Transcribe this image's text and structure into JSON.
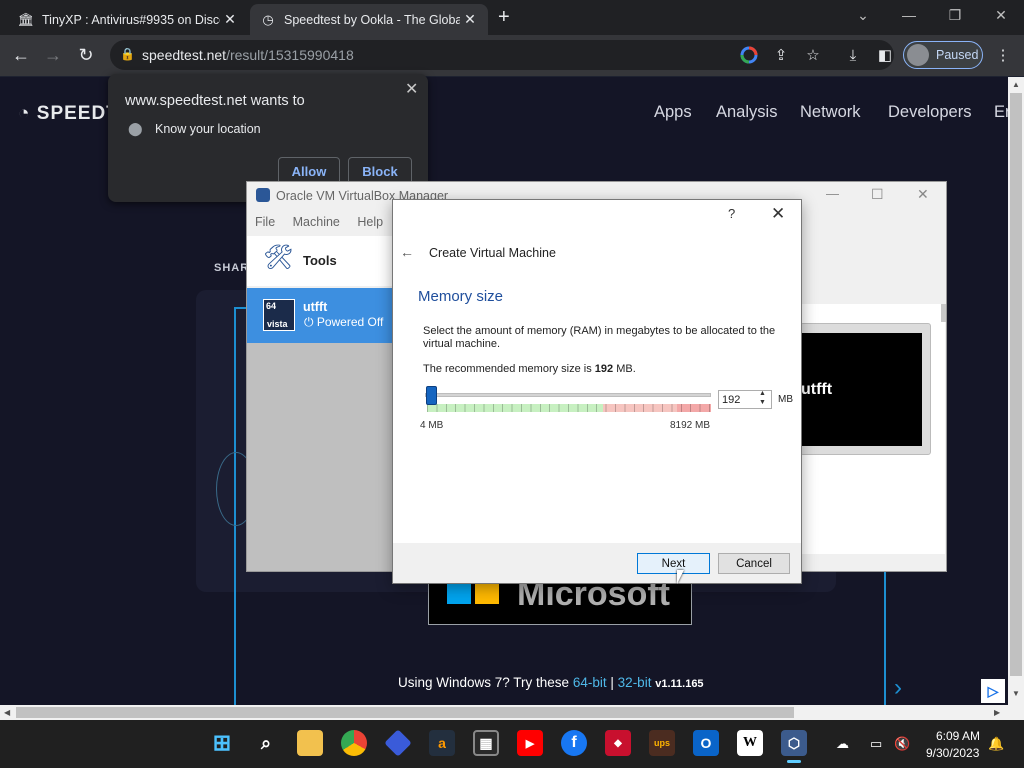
{
  "browser": {
    "tabs": [
      {
        "title": "TinyXP : Antivirus#9935 on Disco",
        "close": "✕"
      },
      {
        "title": "Speedtest by Ookla - The Globa",
        "close": "✕"
      }
    ],
    "new_tab": "+",
    "window_controls": {
      "dropdown": "⌄",
      "minimize": "—",
      "restore": "❐",
      "close": "✕"
    },
    "url_host": "speedtest.net",
    "url_path": "/result/15315990418",
    "profile_status": "Paused",
    "menu": "⋮"
  },
  "site": {
    "logo": "SPEEDT",
    "nav": [
      "Apps",
      "Analysis",
      "Network",
      "Developers",
      "Er"
    ],
    "share_label": "SHAR",
    "ms_text": "Microsoft",
    "win7_prefix": "Using Windows 7? Try these",
    "link_64": "64-bit",
    "sep": "|",
    "link_32": "32-bit",
    "version": "v1.11.165"
  },
  "permission": {
    "title": "www.speedtest.net wants to",
    "desc": "Know your location",
    "allow": "Allow",
    "block": "Block",
    "close": "✕"
  },
  "vbox": {
    "title": "Oracle VM VirtualBox Manager",
    "menu": [
      "File",
      "Machine",
      "Help"
    ],
    "tools": "Tools",
    "vm_name": "utfft",
    "vm_badge_top": "64",
    "vm_badge_bottom": "vista",
    "vm_state": "Powered Off",
    "preview_name": "utfft",
    "win_min": "—",
    "win_max": "☐",
    "win_close": "✕"
  },
  "dialog": {
    "help": "?",
    "close": "✕",
    "back": "←",
    "title": "Create Virtual Machine",
    "heading": "Memory size",
    "desc": "Select the amount of memory (RAM) in megabytes to be allocated to the virtual machine.",
    "rec_prefix": "The recommended memory size is",
    "rec_value": "192",
    "rec_unit": "MB.",
    "slider_min": "4 MB",
    "slider_max": "8192 MB",
    "spin_value": "192",
    "spin_unit": "MB",
    "next": "Next",
    "cancel": "Cancel"
  },
  "taskbar": {
    "time": "6:09 AM",
    "date": "9/30/2023"
  },
  "colors": {
    "accent": "#1d8fd1",
    "vm_selected": "#3d8fe0",
    "dialog_heading": "#1f4e9c"
  }
}
